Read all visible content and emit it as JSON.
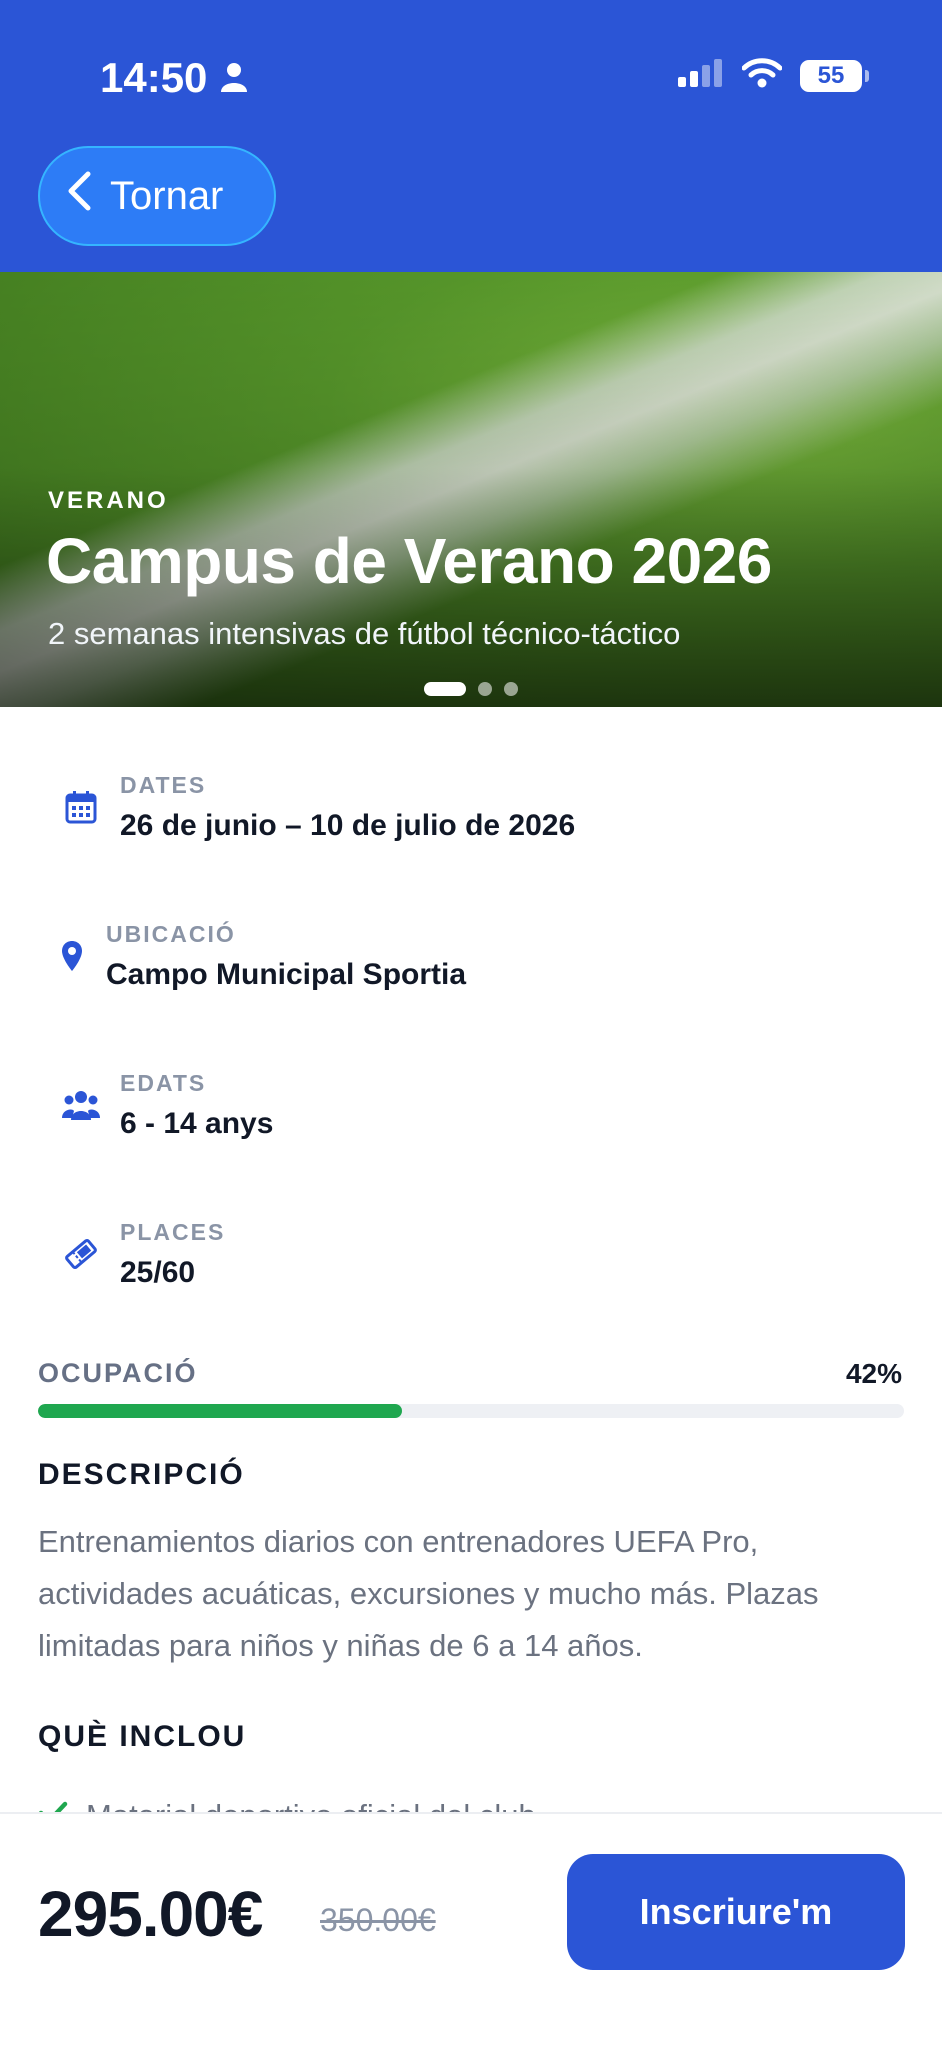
{
  "status_bar": {
    "time": "14:50",
    "battery": "55"
  },
  "header": {
    "back_label": "Tornar"
  },
  "hero": {
    "tag": "VERANO",
    "title": "Campus de Verano 2026",
    "subtitle": "2 semanas intensivas de fútbol técnico-táctico",
    "slide_count": 3,
    "active_slide": 1
  },
  "info": [
    {
      "label": "DATES",
      "value": "26 de junio – 10 de julio de 2026",
      "icon": "calendar-icon"
    },
    {
      "label": "UBICACIÓ",
      "value": "Campo Municipal Sportia",
      "icon": "location-pin-icon"
    },
    {
      "label": "EDATS",
      "value": "6 - 14 anys",
      "icon": "users-group-icon"
    },
    {
      "label": "PLACES",
      "value": "25/60",
      "icon": "ticket-icon"
    }
  ],
  "occupancy": {
    "label": "OCUPACIÓ",
    "value_text": "42%",
    "fraction": 0.42,
    "color": "#1fa74f"
  },
  "description": {
    "title": "DESCRIPCIÓ",
    "text": "Entrenamientos diarios con entrenadores UEFA Pro, actividades acuáticas, excursiones y mucho más. Plazas limitadas para niños y niñas de 6 a 14 años."
  },
  "includes": {
    "title": "QUÈ INCLOU",
    "items": [
      "Material deportivo oficial del club"
    ]
  },
  "footer": {
    "price": "295.00€",
    "old_price": "350.00€",
    "cta_label": "Inscriure'm"
  },
  "colors": {
    "brand": "#2b55d6",
    "success": "#1fa74f",
    "muted": "#8a94a6"
  }
}
